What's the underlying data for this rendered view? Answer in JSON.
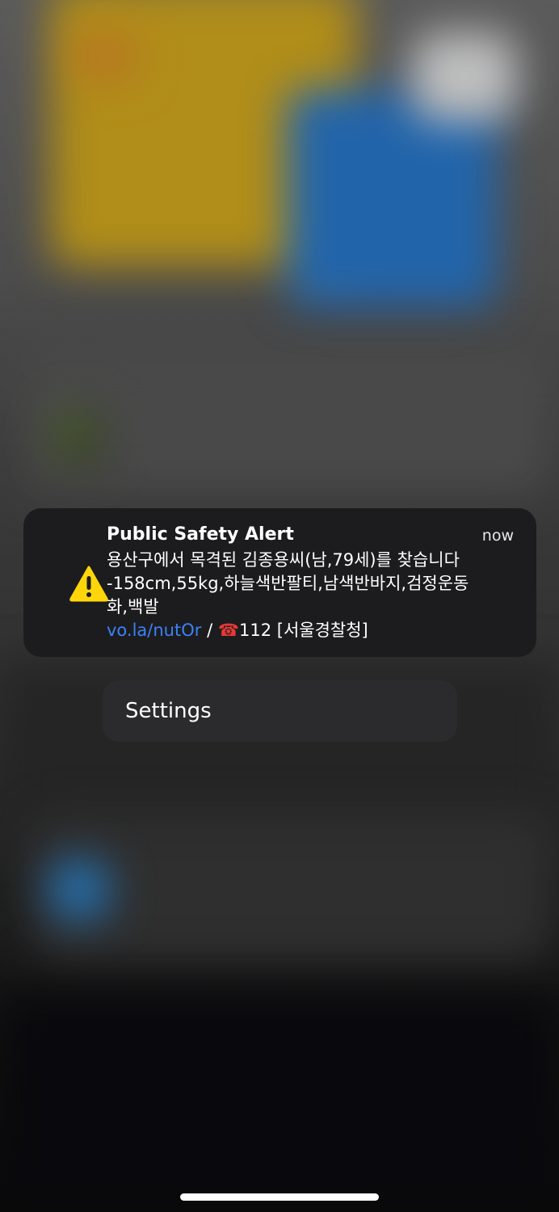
{
  "notification": {
    "title": "Public Safety Alert",
    "time": "now",
    "icon": "warning-triangle-icon",
    "body_line1": "용산구에서 목격된 김종용씨(남,79세)를 찾습니다",
    "body_line2": "-158cm,55kg,하늘색반팔티,남색반바지,검정운동",
    "body_line3": "화,백발",
    "link": "vo.la/nutOr",
    "separator": " / ",
    "phone_glyph": "☎",
    "phone_number": "112",
    "source": " [서울경찰청]"
  },
  "menu": {
    "settings_label": "Settings"
  },
  "colors": {
    "notification_bg": "#1c1c1e",
    "link": "#3b82f6",
    "warning_yellow": "#ffd60a",
    "phone_red": "#e53935"
  }
}
